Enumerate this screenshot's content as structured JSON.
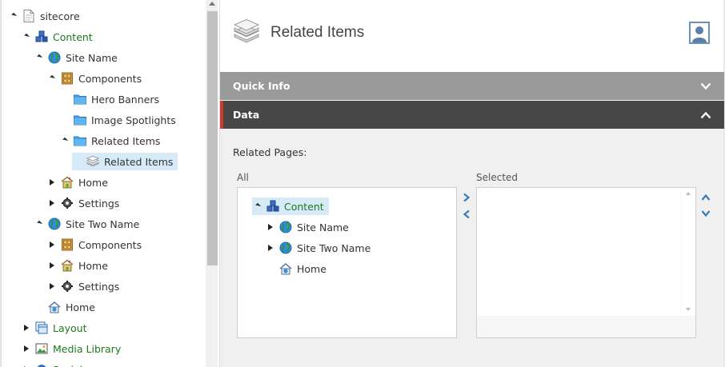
{
  "tree": {
    "items": [
      {
        "label": "sitecore",
        "icon": "document-icon",
        "state": "expanded",
        "depth": 0,
        "color": "#333333"
      },
      {
        "label": "Content",
        "icon": "content-cubes-icon",
        "state": "expanded",
        "depth": 1,
        "color": "#1c7a1c"
      },
      {
        "label": "Site Name",
        "icon": "globe-icon",
        "state": "expanded",
        "depth": 2,
        "color": "#333333"
      },
      {
        "label": "Components",
        "icon": "cabinet-icon",
        "state": "expanded",
        "depth": 3,
        "color": "#333333"
      },
      {
        "label": "Hero Banners",
        "icon": "folder-icon",
        "state": "none",
        "depth": 4,
        "color": "#333333"
      },
      {
        "label": "Image Spotlights",
        "icon": "folder-icon",
        "state": "none",
        "depth": 4,
        "color": "#333333"
      },
      {
        "label": "Related Items",
        "icon": "folder-icon",
        "state": "expanded",
        "depth": 4,
        "color": "#333333"
      },
      {
        "label": "Related Items",
        "icon": "layers-icon",
        "state": "none",
        "depth": 5,
        "color": "#333333",
        "selected": true
      },
      {
        "label": "Home",
        "icon": "home-house-icon",
        "state": "collapsed",
        "depth": 3,
        "color": "#333333"
      },
      {
        "label": "Settings",
        "icon": "gear-icon",
        "state": "collapsed",
        "depth": 3,
        "color": "#333333"
      },
      {
        "label": "Site Two Name",
        "icon": "globe-icon",
        "state": "expanded",
        "depth": 2,
        "color": "#333333"
      },
      {
        "label": "Components",
        "icon": "cabinet-icon",
        "state": "collapsed",
        "depth": 3,
        "color": "#333333"
      },
      {
        "label": "Home",
        "icon": "home-house-icon",
        "state": "collapsed",
        "depth": 3,
        "color": "#333333"
      },
      {
        "label": "Settings",
        "icon": "gear-icon",
        "state": "collapsed",
        "depth": 3,
        "color": "#333333"
      },
      {
        "label": "Home",
        "icon": "home-globe-icon",
        "state": "none",
        "depth": 2,
        "color": "#333333"
      },
      {
        "label": "Layout",
        "icon": "layout-icon",
        "state": "collapsed",
        "depth": 1,
        "color": "#1c7a1c"
      },
      {
        "label": "Media Library",
        "icon": "media-icon",
        "state": "collapsed",
        "depth": 1,
        "color": "#1c7a1c"
      },
      {
        "label": "Social",
        "icon": "social-icon",
        "state": "collapsed",
        "depth": 1,
        "color": "#1c7a1c"
      }
    ]
  },
  "editor": {
    "title": "Related Items",
    "sections": {
      "quick_info": "Quick Info",
      "data": "Data"
    },
    "field_label": "Related Pages:",
    "all_label": "All",
    "selected_label": "Selected",
    "all_tree": [
      {
        "label": "Content",
        "icon": "content-cubes-icon",
        "state": "expanded",
        "depth": 0,
        "highlight": true,
        "color": "#1c7a1c"
      },
      {
        "label": "Site Name",
        "icon": "globe-icon",
        "state": "collapsed",
        "depth": 1,
        "color": "#333333"
      },
      {
        "label": "Site Two Name",
        "icon": "globe-icon",
        "state": "collapsed",
        "depth": 1,
        "color": "#333333"
      },
      {
        "label": "Home",
        "icon": "home-globe-icon",
        "state": "none",
        "depth": 1,
        "color": "#333333"
      }
    ],
    "selected_items": []
  },
  "colors": {
    "quick_info_bar": "#9a9a9a",
    "data_bar": "#474747",
    "data_accent": "#d0392b",
    "selection": "#d6eaf7",
    "tree_green": "#1c7a1c",
    "arrow_blue": "#3a7ab8"
  }
}
